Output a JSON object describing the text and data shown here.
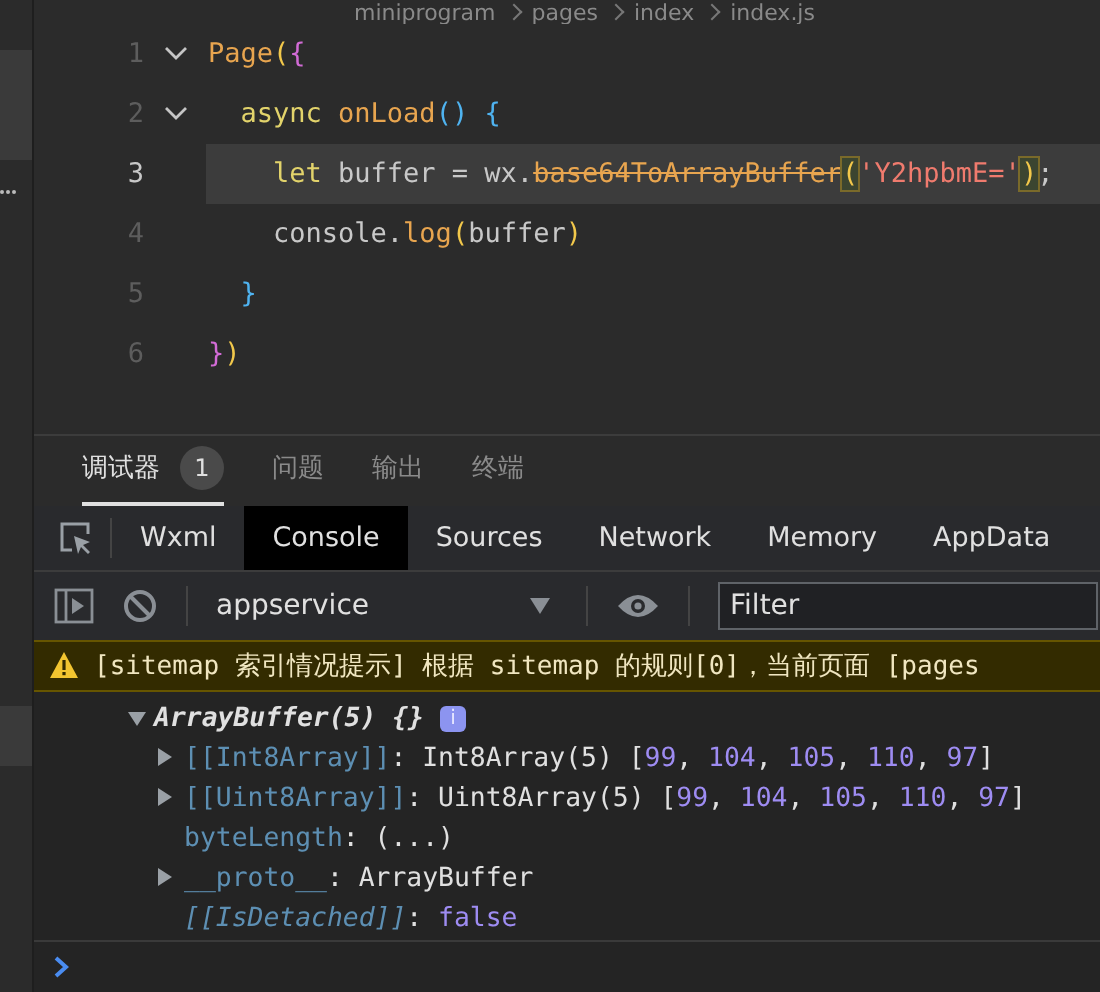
{
  "breadcrumb": [
    "miniprogram",
    "pages",
    "index",
    "index.js"
  ],
  "code_lines": [
    {
      "number": "1",
      "current": false,
      "foldable": true,
      "tokens": [
        {
          "text": "Page",
          "kind": "call"
        },
        {
          "text": "(",
          "kind": "gold"
        },
        {
          "text": "{",
          "kind": "pink"
        }
      ]
    },
    {
      "number": "2",
      "current": false,
      "foldable": true,
      "tokens": [
        {
          "text": "  async ",
          "kind": "keyword"
        },
        {
          "text": "onLoad",
          "kind": "call"
        },
        {
          "text": "() {",
          "kind": "blue"
        }
      ]
    },
    {
      "number": "3",
      "current": true,
      "foldable": false,
      "tokens": [
        {
          "text": "    let ",
          "kind": "keyword"
        },
        {
          "text": "buffer = wx.",
          "kind": "plain"
        },
        {
          "text": "base64ToArrayBuffer",
          "kind": "deprecated"
        },
        {
          "text": "(",
          "kind": "match"
        },
        {
          "text": "'Y2hpbmE='",
          "kind": "string"
        },
        {
          "text": ")",
          "kind": "match"
        },
        {
          "text": ";",
          "kind": "plain"
        }
      ]
    },
    {
      "number": "4",
      "current": false,
      "foldable": false,
      "tokens": [
        {
          "text": "    console.",
          "kind": "plain"
        },
        {
          "text": "log",
          "kind": "call"
        },
        {
          "text": "(",
          "kind": "gold"
        },
        {
          "text": "buffer",
          "kind": "plain"
        },
        {
          "text": ")",
          "kind": "gold"
        }
      ]
    },
    {
      "number": "5",
      "current": false,
      "foldable": false,
      "tokens": [
        {
          "text": "  }",
          "kind": "blue"
        }
      ]
    },
    {
      "number": "6",
      "current": false,
      "foldable": false,
      "tokens": [
        {
          "text": "}",
          "kind": "pink"
        },
        {
          "text": ")",
          "kind": "gold"
        }
      ]
    }
  ],
  "panel_tabs": [
    {
      "label": "调试器",
      "selected": true,
      "badge": "1"
    },
    {
      "label": "问题",
      "selected": false
    },
    {
      "label": "输出",
      "selected": false
    },
    {
      "label": "终端",
      "selected": false
    }
  ],
  "devtools_tabs": [
    {
      "label": "Wxml",
      "selected": false
    },
    {
      "label": "Console",
      "selected": true
    },
    {
      "label": "Sources",
      "selected": false
    },
    {
      "label": "Network",
      "selected": false
    },
    {
      "label": "Memory",
      "selected": false
    },
    {
      "label": "AppData",
      "selected": false
    }
  ],
  "context_select": {
    "value": "appservice"
  },
  "filter": {
    "placeholder": "Filter"
  },
  "warning": {
    "text": "[sitemap 索引情况提示] 根据 sitemap 的规则[0]，当前页面 [pages"
  },
  "console_tree": {
    "label": "ArrayBuffer(5) {}",
    "expanded": true,
    "badge": "i",
    "children": [
      {
        "key": "[[Int8Array]]",
        "kind": "internal",
        "expandable": true,
        "sep": ": ",
        "value": [
          {
            "text": "Int8Array(5) [",
            "kind": "plain"
          },
          {
            "text": "99",
            "kind": "num"
          },
          {
            "text": ", ",
            "kind": "plain"
          },
          {
            "text": "104",
            "kind": "num"
          },
          {
            "text": ", ",
            "kind": "plain"
          },
          {
            "text": "105",
            "kind": "num"
          },
          {
            "text": ", ",
            "kind": "plain"
          },
          {
            "text": "110",
            "kind": "num"
          },
          {
            "text": ", ",
            "kind": "plain"
          },
          {
            "text": "97",
            "kind": "num"
          },
          {
            "text": "]",
            "kind": "plain"
          }
        ]
      },
      {
        "key": "[[Uint8Array]]",
        "kind": "internal",
        "expandable": true,
        "sep": ": ",
        "value": [
          {
            "text": "Uint8Array(5) [",
            "kind": "plain"
          },
          {
            "text": "99",
            "kind": "num"
          },
          {
            "text": ", ",
            "kind": "plain"
          },
          {
            "text": "104",
            "kind": "num"
          },
          {
            "text": ", ",
            "kind": "plain"
          },
          {
            "text": "105",
            "kind": "num"
          },
          {
            "text": ", ",
            "kind": "plain"
          },
          {
            "text": "110",
            "kind": "num"
          },
          {
            "text": ", ",
            "kind": "plain"
          },
          {
            "text": "97",
            "kind": "num"
          },
          {
            "text": "]",
            "kind": "plain"
          }
        ]
      },
      {
        "key": "byteLength",
        "kind": "getter",
        "expandable": false,
        "sep": ": ",
        "value": [
          {
            "text": "(...)",
            "kind": "plain"
          }
        ]
      },
      {
        "key": "__proto__",
        "kind": "property",
        "expandable": true,
        "sep": ": ",
        "value": [
          {
            "text": "ArrayBuffer",
            "kind": "plain"
          }
        ]
      },
      {
        "key": "[[IsDetached]]",
        "kind": "hidden",
        "expandable": false,
        "sep": ": ",
        "value": [
          {
            "text": "false",
            "kind": "num"
          }
        ]
      }
    ]
  }
}
